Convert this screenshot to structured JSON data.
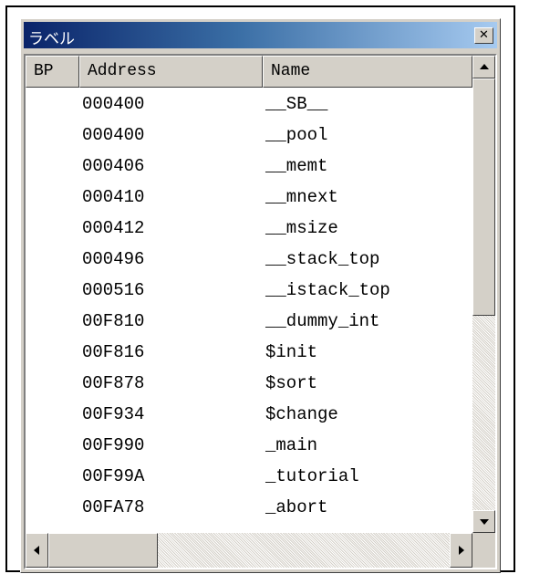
{
  "window": {
    "title": "ラベル"
  },
  "columns": {
    "bp": "BP",
    "address": "Address",
    "name": "Name"
  },
  "rows": [
    {
      "address": "000400",
      "name": "__SB__"
    },
    {
      "address": "000400",
      "name": "__pool"
    },
    {
      "address": "000406",
      "name": "__memt"
    },
    {
      "address": "000410",
      "name": "__mnext"
    },
    {
      "address": "000412",
      "name": "__msize"
    },
    {
      "address": "000496",
      "name": "__stack_top"
    },
    {
      "address": "000516",
      "name": "__istack_top"
    },
    {
      "address": "00F810",
      "name": "__dummy_int"
    },
    {
      "address": "00F816",
      "name": "$init"
    },
    {
      "address": "00F878",
      "name": "$sort"
    },
    {
      "address": "00F934",
      "name": "$change"
    },
    {
      "address": "00F990",
      "name": "_main"
    },
    {
      "address": "00F99A",
      "name": "_tutorial"
    },
    {
      "address": "00FA78",
      "name": "_abort"
    }
  ],
  "icons": {
    "close": "close-icon",
    "scroll_up": "triangle-up-icon",
    "scroll_down": "triangle-down-icon",
    "scroll_left": "triangle-left-icon",
    "scroll_right": "triangle-right-icon"
  },
  "colors": {
    "titlebar_start": "#0a246a",
    "titlebar_end": "#a6caf0",
    "face": "#d4d0c8"
  }
}
